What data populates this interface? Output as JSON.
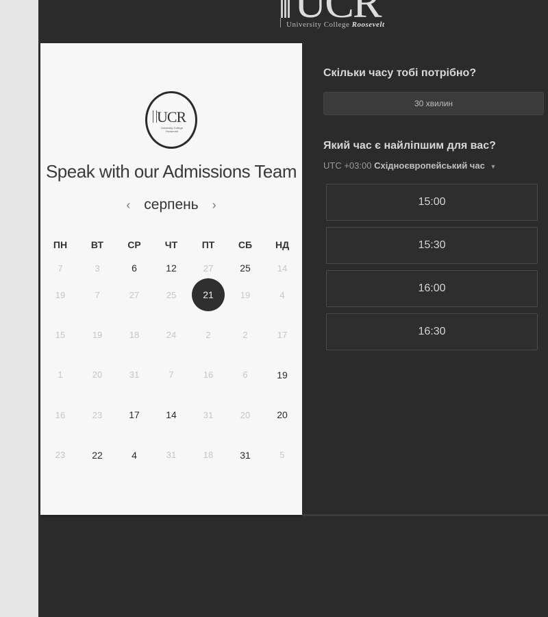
{
  "header": {
    "logo_letters": "UCR",
    "logo_subtitle_plain": "University College ",
    "logo_subtitle_bold": "Roosevelt"
  },
  "card": {
    "logo_letters": "UCR",
    "logo_subtitle": "University College Roosevelt",
    "title": "Speak with our Admissions Team",
    "month": "серпень",
    "prev_arrow": "‹",
    "next_arrow": "›"
  },
  "calendar": {
    "weekdays": [
      "ПН",
      "ВТ",
      "СР",
      "ЧТ",
      "ПТ",
      "СБ",
      "НД"
    ],
    "weeks": [
      [
        {
          "d": "7",
          "s": "na"
        },
        {
          "d": "3",
          "s": "na"
        },
        {
          "d": "6",
          "s": "av"
        },
        {
          "d": "12",
          "s": "av"
        },
        {
          "d": "27",
          "s": "na"
        },
        {
          "d": "25",
          "s": "av"
        },
        {
          "d": "14",
          "s": "na"
        }
      ],
      [
        {
          "d": "19",
          "s": "na"
        },
        {
          "d": "7",
          "s": "na"
        },
        {
          "d": "27",
          "s": "na"
        },
        {
          "d": "25",
          "s": "na"
        },
        {
          "d": "21",
          "s": "sel"
        },
        {
          "d": "19",
          "s": "na"
        },
        {
          "d": "4",
          "s": "na"
        }
      ],
      [
        {
          "d": "15",
          "s": "na"
        },
        {
          "d": "19",
          "s": "na"
        },
        {
          "d": "18",
          "s": "na"
        },
        {
          "d": "24",
          "s": "na"
        },
        {
          "d": "2",
          "s": "na"
        },
        {
          "d": "2",
          "s": "na"
        },
        {
          "d": "17",
          "s": "na"
        }
      ],
      [
        {
          "d": "1",
          "s": "na"
        },
        {
          "d": "20",
          "s": "na"
        },
        {
          "d": "31",
          "s": "na"
        },
        {
          "d": "7",
          "s": "na"
        },
        {
          "d": "16",
          "s": "na"
        },
        {
          "d": "6",
          "s": "na"
        },
        {
          "d": "19",
          "s": "av"
        }
      ],
      [
        {
          "d": "16",
          "s": "na"
        },
        {
          "d": "23",
          "s": "na"
        },
        {
          "d": "17",
          "s": "av"
        },
        {
          "d": "14",
          "s": "av"
        },
        {
          "d": "31",
          "s": "na"
        },
        {
          "d": "20",
          "s": "na"
        },
        {
          "d": "20",
          "s": "av"
        }
      ],
      [
        {
          "d": "23",
          "s": "na"
        },
        {
          "d": "22",
          "s": "av"
        },
        {
          "d": "4",
          "s": "av"
        },
        {
          "d": "31",
          "s": "na"
        },
        {
          "d": "18",
          "s": "na"
        },
        {
          "d": "31",
          "s": "av"
        },
        {
          "d": "5",
          "s": "na"
        }
      ]
    ]
  },
  "booking": {
    "duration_question": "Скільки часу тобі потрібно?",
    "duration_value": "30 хвилин",
    "time_question": "Який час є найліпшим для вас?",
    "timezone_offset": "UTC +03:00",
    "timezone_name": "Східноєвропейський час",
    "timezone_caret": "▼",
    "slots": [
      "15:00",
      "15:30",
      "16:00",
      "16:30"
    ]
  }
}
